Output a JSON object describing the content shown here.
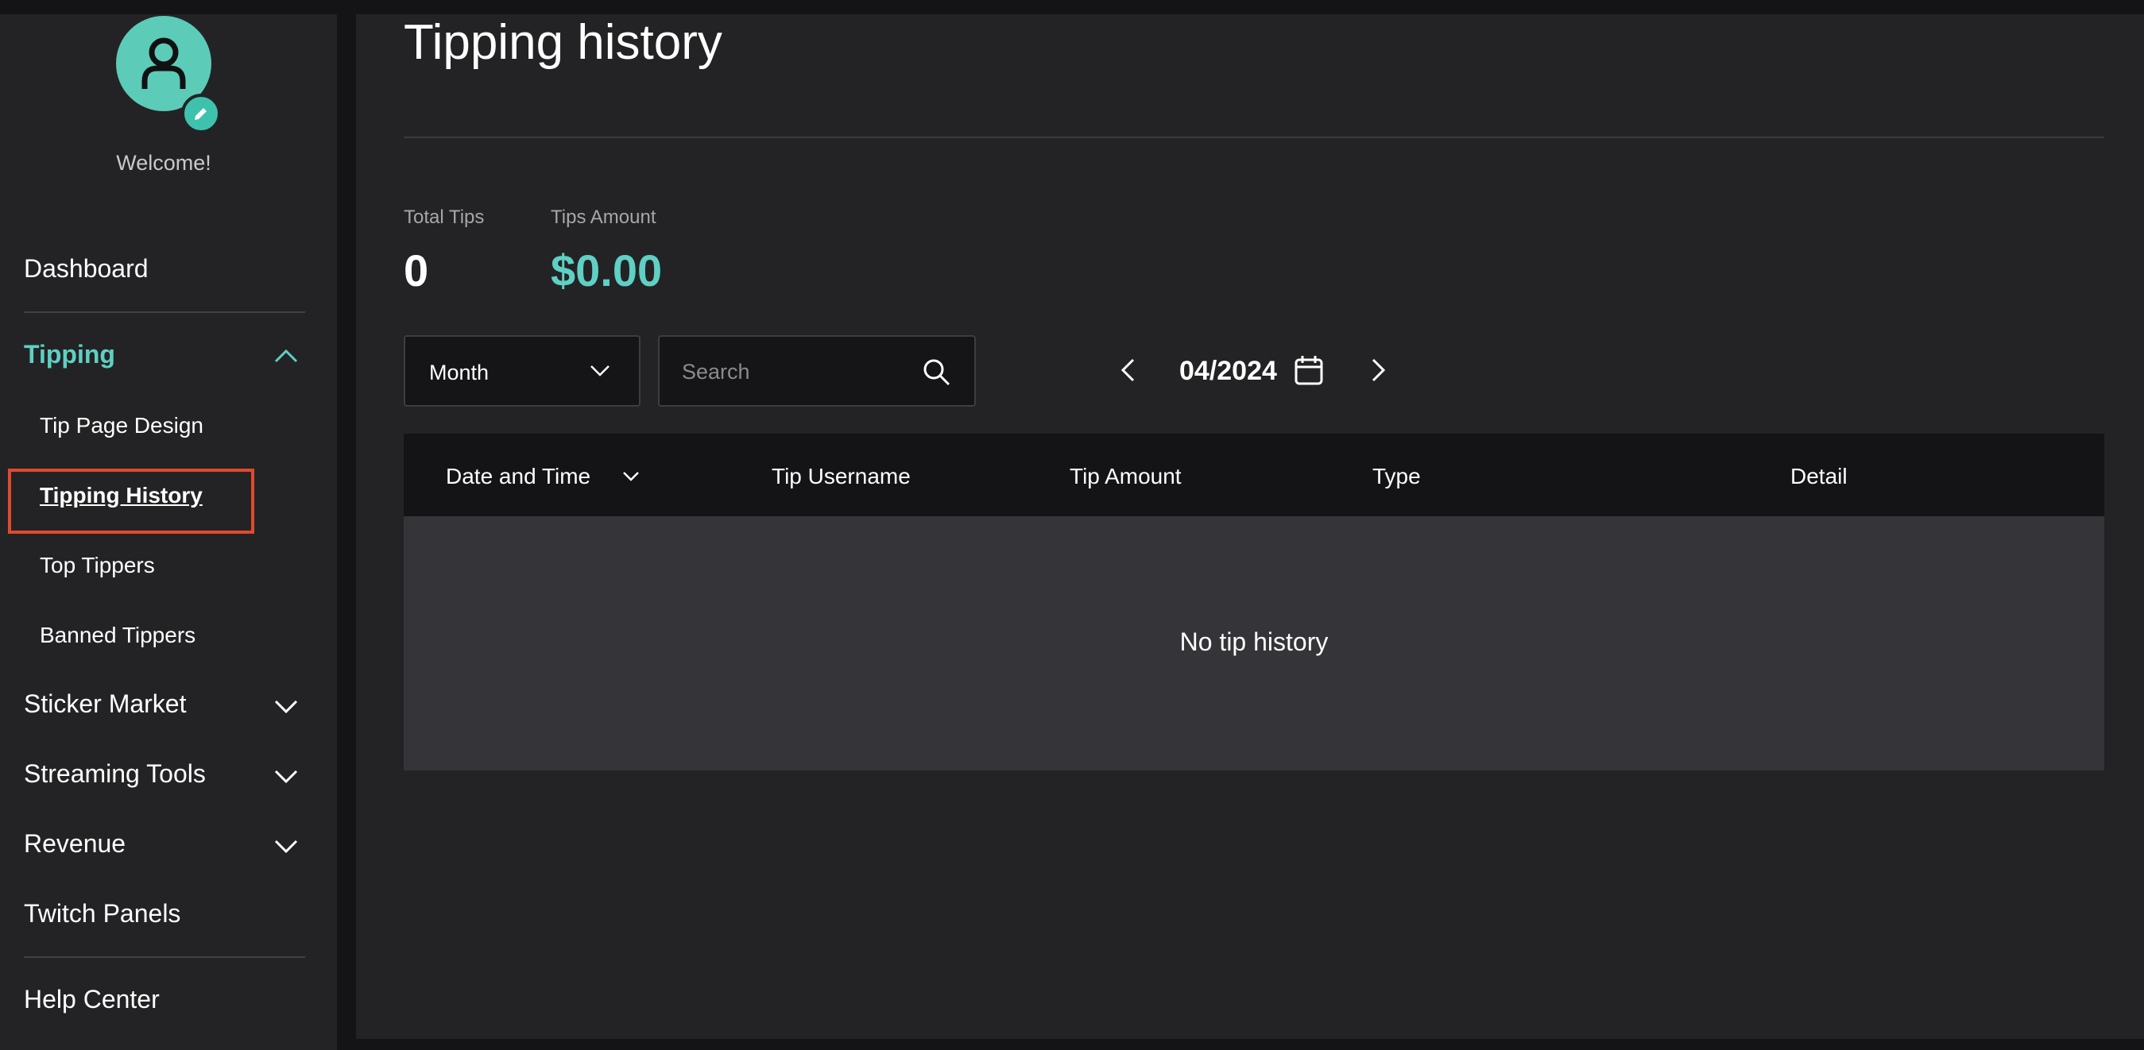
{
  "sidebar": {
    "welcome": "Welcome!",
    "nav": {
      "dashboard": "Dashboard",
      "tipping": "Tipping",
      "tipping_sub": {
        "tip_page_design": "Tip Page Design",
        "tipping_history": "Tipping History",
        "top_tippers": "Top Tippers",
        "banned_tippers": "Banned Tippers"
      },
      "sticker_market": "Sticker Market",
      "streaming_tools": "Streaming Tools",
      "revenue": "Revenue",
      "twitch_panels": "Twitch Panels",
      "help_center": "Help Center"
    }
  },
  "main": {
    "title": "Tipping history",
    "stats": {
      "total_tips_label": "Total Tips",
      "total_tips_value": "0",
      "tips_amount_label": "Tips Amount",
      "tips_amount_value": "$0.00"
    },
    "filters": {
      "period_select": "Month",
      "search_placeholder": "Search",
      "date": "04/2024"
    },
    "table": {
      "columns": [
        "Date and Time",
        "Tip Username",
        "Tip Amount",
        "Type",
        "Detail"
      ],
      "empty_message": "No tip history"
    }
  },
  "colors": {
    "accent": "#5fd0c3",
    "avatar": "#5ccbb8",
    "highlight": "#e04a2e",
    "panel": "#232325",
    "background": "#141416"
  }
}
